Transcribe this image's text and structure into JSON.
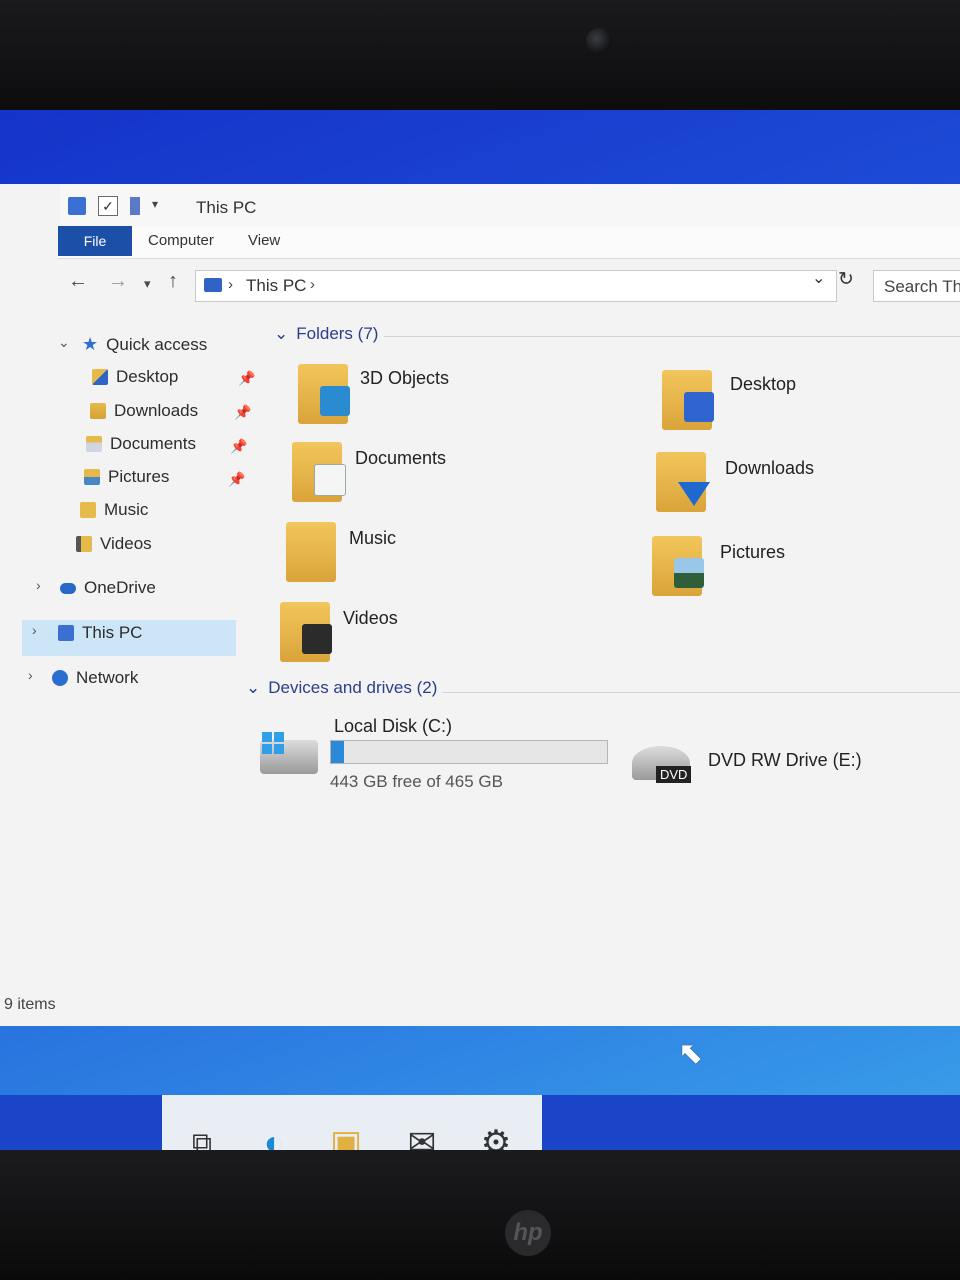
{
  "window": {
    "title": "This PC",
    "ribbon_tabs": [
      "File",
      "Computer",
      "View"
    ]
  },
  "address": {
    "path": "This PC",
    "search_placeholder": "Search Th"
  },
  "nav": {
    "quick_access": "Quick access",
    "items": [
      {
        "label": "Desktop",
        "pinned": true,
        "icon": "desktop-folder-icon"
      },
      {
        "label": "Downloads",
        "pinned": true,
        "icon": "downloads-folder-icon"
      },
      {
        "label": "Documents",
        "pinned": true,
        "icon": "documents-folder-icon"
      },
      {
        "label": "Pictures",
        "pinned": true,
        "icon": "pictures-folder-icon"
      },
      {
        "label": "Music",
        "pinned": false,
        "icon": "music-folder-icon"
      },
      {
        "label": "Videos",
        "pinned": false,
        "icon": "videos-folder-icon"
      }
    ],
    "onedrive": "OneDrive",
    "this_pc": "This PC",
    "network": "Network"
  },
  "folders": {
    "header": "Folders (7)",
    "items": [
      "3D Objects",
      "Desktop",
      "Documents",
      "Downloads",
      "Music",
      "Pictures",
      "Videos"
    ]
  },
  "drives": {
    "header": "Devices and drives (2)",
    "local": {
      "name": "Local Disk (C:)",
      "free_text": "443 GB free of 465 GB",
      "used_fraction": 0.047
    },
    "dvd": {
      "name": "DVD RW Drive (E:)",
      "badge": "DVD"
    }
  },
  "status": {
    "items": "9 items"
  },
  "colors": {
    "accent": "#1c4fa8",
    "selection": "#cde6f7",
    "taskbar": "#1b45c9"
  }
}
